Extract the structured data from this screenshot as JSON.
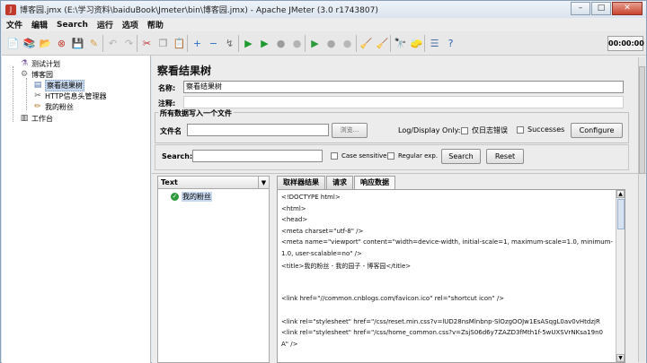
{
  "window": {
    "title": "博客园.jmx (E:\\学习资料\\baiduBook\\Jmeter\\bin\\博客园.jmx) - Apache JMeter (3.0 r1743807)",
    "minimize": "–",
    "maximize": "□",
    "close": "✕"
  },
  "menubar": {
    "items": [
      "文件",
      "编辑",
      "Search",
      "运行",
      "选项",
      "帮助"
    ]
  },
  "toolbar": {
    "timer": "00:00:00",
    "icons": [
      {
        "name": "new-icon",
        "glyph": "📄",
        "color": "#f4f4f4"
      },
      {
        "name": "templates-icon",
        "glyph": "📚",
        "color": "#3a8a3a"
      },
      {
        "name": "open-icon",
        "glyph": "📂",
        "color": "#e6b84a"
      },
      {
        "name": "close-icon",
        "glyph": "⊗",
        "color": "#c0392b"
      },
      {
        "name": "save-icon",
        "glyph": "💾",
        "color": "#8ea4c8"
      },
      {
        "name": "save-as-icon",
        "glyph": "✎",
        "color": "#d8a040"
      },
      {
        "name": "undo-icon",
        "glyph": "↶",
        "color": "#b0b0b0"
      },
      {
        "name": "redo-icon",
        "glyph": "↷",
        "color": "#b0b0b0"
      },
      {
        "name": "cut-icon",
        "glyph": "✂",
        "color": "#c03030"
      },
      {
        "name": "copy-icon",
        "glyph": "❐",
        "color": "#8f8f8f"
      },
      {
        "name": "paste-icon",
        "glyph": "📋",
        "color": "#b08a50"
      },
      {
        "name": "expand-icon",
        "glyph": "+",
        "color": "#2c6fc4"
      },
      {
        "name": "collapse-icon",
        "glyph": "−",
        "color": "#2c6fc4"
      },
      {
        "name": "toggle-icon",
        "glyph": "↯",
        "color": "#6b6b6b"
      },
      {
        "name": "start-icon",
        "glyph": "▶",
        "color": "#1e9a2e"
      },
      {
        "name": "start-no-pause-icon",
        "glyph": "▶",
        "color": "#1e9a2e"
      },
      {
        "name": "stop-icon",
        "glyph": "●",
        "color": "#9c9c9c"
      },
      {
        "name": "shutdown-icon",
        "glyph": "●",
        "color": "#b3b3b3"
      },
      {
        "name": "remote-start-icon",
        "glyph": "▶",
        "color": "#2b9a3b"
      },
      {
        "name": "remote-stop-icon",
        "glyph": "●",
        "color": "#a8a8a8"
      },
      {
        "name": "remote-shutdown-icon",
        "glyph": "●",
        "color": "#b8b8b8"
      },
      {
        "name": "clear-icon",
        "glyph": "🧹",
        "color": "#c9a050"
      },
      {
        "name": "clear-all-icon",
        "glyph": "🧹",
        "color": "#b98a40"
      },
      {
        "name": "search-icon",
        "glyph": "🔭",
        "color": "#555555"
      },
      {
        "name": "reset-search-icon",
        "glyph": "🧽",
        "color": "#d0a030"
      },
      {
        "name": "function-helper-icon",
        "glyph": "☰",
        "color": "#4a6ea8"
      },
      {
        "name": "help-icon",
        "glyph": "?",
        "color": "#2d5fb0"
      }
    ]
  },
  "tree": {
    "items": [
      {
        "label": "测试计划",
        "icon": "test-plan-icon",
        "glyph": "⚗"
      },
      {
        "label": "博客园",
        "icon": "thread-group-icon",
        "glyph": "⚙"
      },
      {
        "label": "察看结果树",
        "icon": "results-tree-icon",
        "glyph": "▤"
      },
      {
        "label": "HTTP信息头管理器",
        "icon": "header-manager-icon",
        "glyph": "✂"
      },
      {
        "label": "我的粉丝",
        "icon": "http-sampler-icon",
        "glyph": "✏"
      },
      {
        "label": "工作台",
        "icon": "workbench-icon",
        "glyph": "▥"
      }
    ]
  },
  "panel": {
    "title": "察看结果树",
    "name_label": "名称:",
    "name_value": "察看结果树",
    "comment_label": "注释:",
    "comment_value": "",
    "group_title": "所有数据写入一个文件",
    "filename_label": "文件名",
    "filename_value": "",
    "browse_label": "浏览...",
    "log_display_label": "Log/Display Only:",
    "errors_only_label": "仅日志错误",
    "successes_label": "Successes",
    "configure_label": "Configure",
    "search_label": "Search:",
    "search_value": "",
    "case_sensitive_label": "Case sensitive",
    "regex_label": "Regular exp.",
    "search_button": "Search",
    "reset_button": "Reset"
  },
  "results": {
    "header": "Text",
    "items": [
      "我的粉丝"
    ]
  },
  "viewer": {
    "tabs": [
      "取样器结果",
      "请求",
      "响应数据"
    ],
    "lines": [
      "<!DOCTYPE html>",
      "<html>",
      "<head>",
      "    <meta charset=\"utf-8\" />",
      "    <meta name=\"viewport\" content=\"width=device-width, initial-scale=1, maximum-scale=1.0, minimum-",
      "1.0, user-scalable=no\" />",
      "    <title>我的粉丝 - 我的园子 - 博客园</title>",
      "",
      "",
      "    <link href=\"//common.cnblogs.com/favicon.ico\" rel=\"shortcut icon\" />",
      "",
      "    <link rel=\"stylesheet\" href=\"/css/reset.min.css?v=lUD28nsMlnbnp-SlOzgOOJw1EsASqgL0av0vHtdzjR",
      "    <link rel=\"stylesheet\" href=\"/css/home_common.css?v=ZsjS06d6y7ZAZD3fMth1f-5wUXSVrNKsa19n0",
      "A\" />"
    ]
  }
}
